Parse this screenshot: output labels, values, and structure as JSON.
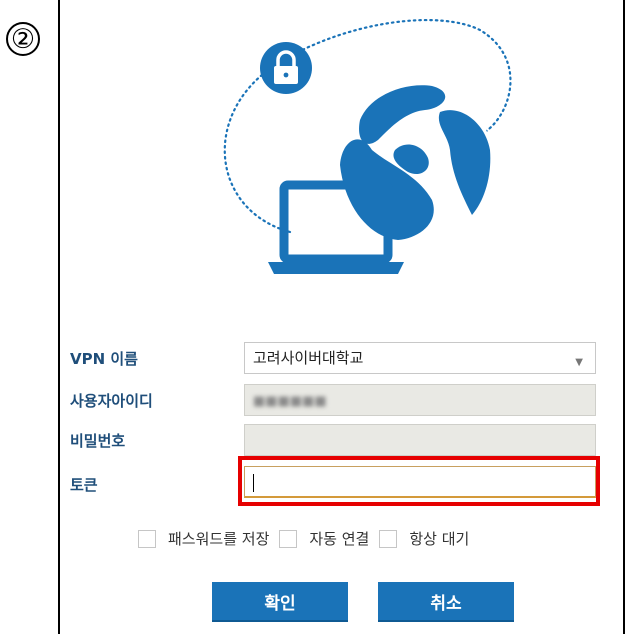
{
  "step_marker": "②",
  "form": {
    "vpn_label": "VPN 이름",
    "vpn_value": "고려사이버대학교",
    "vpn_arrow": "▼",
    "user_label": "사용자아이디",
    "user_value": "■■■■■■",
    "password_label": "비밀번호",
    "password_value": "",
    "token_label": "토큰",
    "token_value": ""
  },
  "options": {
    "save_password": "패스워드를 저장",
    "auto_connect": "자동 연결",
    "always_standby": "항상 대기"
  },
  "buttons": {
    "ok": "확인",
    "cancel": "취소"
  },
  "colors": {
    "accent": "#1a73b8",
    "label": "#1f4e7a",
    "highlight": "#e60000"
  },
  "icons": [
    "lock-icon",
    "globe-icon",
    "laptop-icon"
  ]
}
